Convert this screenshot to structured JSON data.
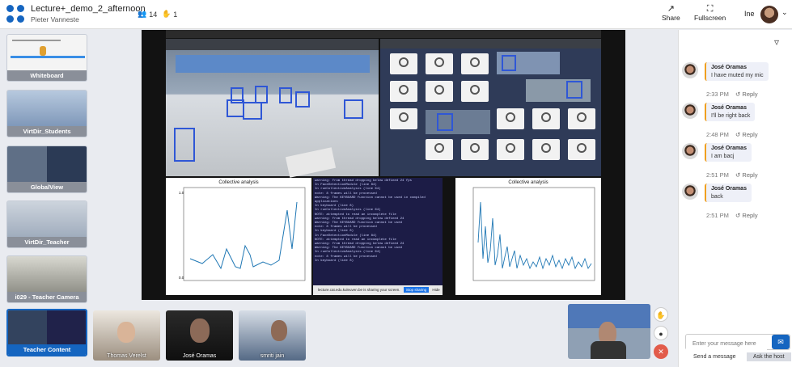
{
  "header": {
    "title": "Lecture+_demo_2_afternoon",
    "subtitle": "Pieter Vanneste",
    "participant_count": "14",
    "hand_count": "1",
    "share_label": "Share",
    "fullscreen_label": "Fullscreen",
    "user_name": "Ine"
  },
  "sidebar": {
    "items": [
      {
        "label": "Whiteboard",
        "active": false
      },
      {
        "label": "VirtDir_Students",
        "active": false
      },
      {
        "label": "GlobalView",
        "active": false
      },
      {
        "label": "VirtDir_Teacher",
        "active": false
      },
      {
        "label": "i029 - Teacher Camera",
        "active": false
      },
      {
        "label": "Teacher Content",
        "active": true
      }
    ]
  },
  "shared_screen": {
    "chart_title_left": "Collective analysis",
    "chart_title_right": "Collective analysis",
    "seat_label": "Free Seat",
    "share_notice": "lecture.cat.edu.kuleuven.be is sharing your screen.",
    "stop_sharing_label": "Stop sharing",
    "hide_label": "Hide"
  },
  "participants": [
    {
      "name": "Thomas Verelst"
    },
    {
      "name": "José Oramas"
    },
    {
      "name": "smriti jain"
    }
  ],
  "chat": {
    "messages": [
      {
        "author": "José Oramas",
        "text": "I have muted my mic",
        "time": "2:33 PM",
        "reply": "Reply"
      },
      {
        "author": "José Oramas",
        "text": "I'll be right back",
        "time": "2:48 PM",
        "reply": "Reply"
      },
      {
        "author": "José Oramas",
        "text": "I am bacj",
        "time": "2:51 PM",
        "reply": "Reply"
      },
      {
        "author": "José Oramas",
        "text": "back",
        "time": "2:51 PM",
        "reply": "Reply"
      }
    ],
    "input_placeholder": "Enter your message here",
    "tab_send": "Send a message",
    "tab_ask": "Ask the host"
  },
  "colors": {
    "accent": "#1565c0",
    "reply_marker": "#f0a020"
  }
}
